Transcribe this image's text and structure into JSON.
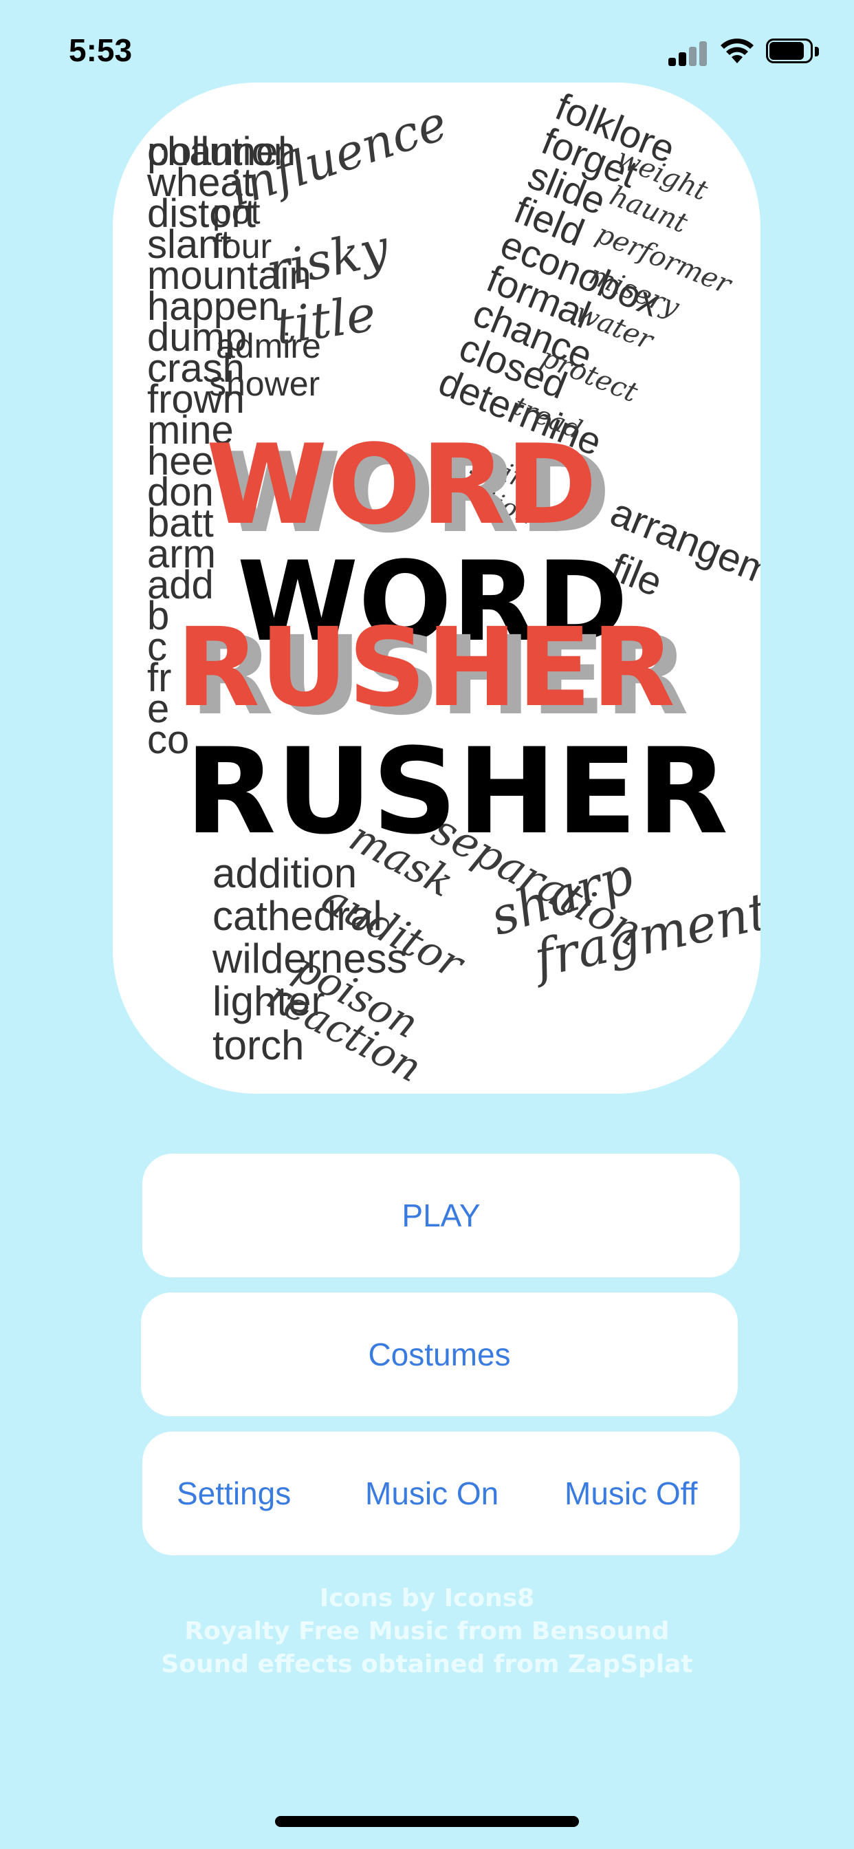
{
  "status_bar": {
    "time": "5:53",
    "icons": [
      "signal-icon",
      "wifi-icon",
      "battery-icon"
    ]
  },
  "logo": {
    "title_line1": "WORD",
    "title_line2": "RUSHER",
    "colors": {
      "accent": "#e74c3c",
      "dark": "#000000",
      "shadow": "#a8a8a8"
    },
    "background_words_sans": [
      "pollution",
      "wheat",
      "distort",
      "slant",
      "mountain",
      "happen",
      "dump",
      "crash",
      "frown",
      "mine",
      "hee",
      "don",
      "batt",
      "arm",
      "add",
      "b",
      "c",
      "fr",
      "e",
      "co",
      "addition",
      "cathedral",
      "wilderness",
      "lighter",
      "torch",
      "folklore",
      "forget",
      "slide",
      "field",
      "econobox",
      "formal",
      "chance",
      "closed",
      "determine",
      "pot",
      "four",
      "admire",
      "shower",
      "arrangement",
      "file",
      "channel"
    ],
    "background_words_script": [
      "influence",
      "risky",
      "title",
      "weight",
      "haunt",
      "performer",
      "misery",
      "water",
      "protect",
      "tread",
      "gain",
      "action",
      "mask",
      "auditor",
      "poison",
      "reaction",
      "separation",
      "sharp",
      "fragment"
    ]
  },
  "buttons": {
    "play": "PLAY",
    "costumes": "Costumes",
    "settings": "Settings",
    "music_on": "Music On",
    "music_off": "Music Off"
  },
  "credits": {
    "line1": "Icons by Icons8",
    "line2": "Royalty Free Music from Bensound",
    "line3": "Sound effects obtained from ZapSplat"
  },
  "colors": {
    "background": "#c2f1fc",
    "button_text": "#3a7be0",
    "card": "#ffffff"
  }
}
